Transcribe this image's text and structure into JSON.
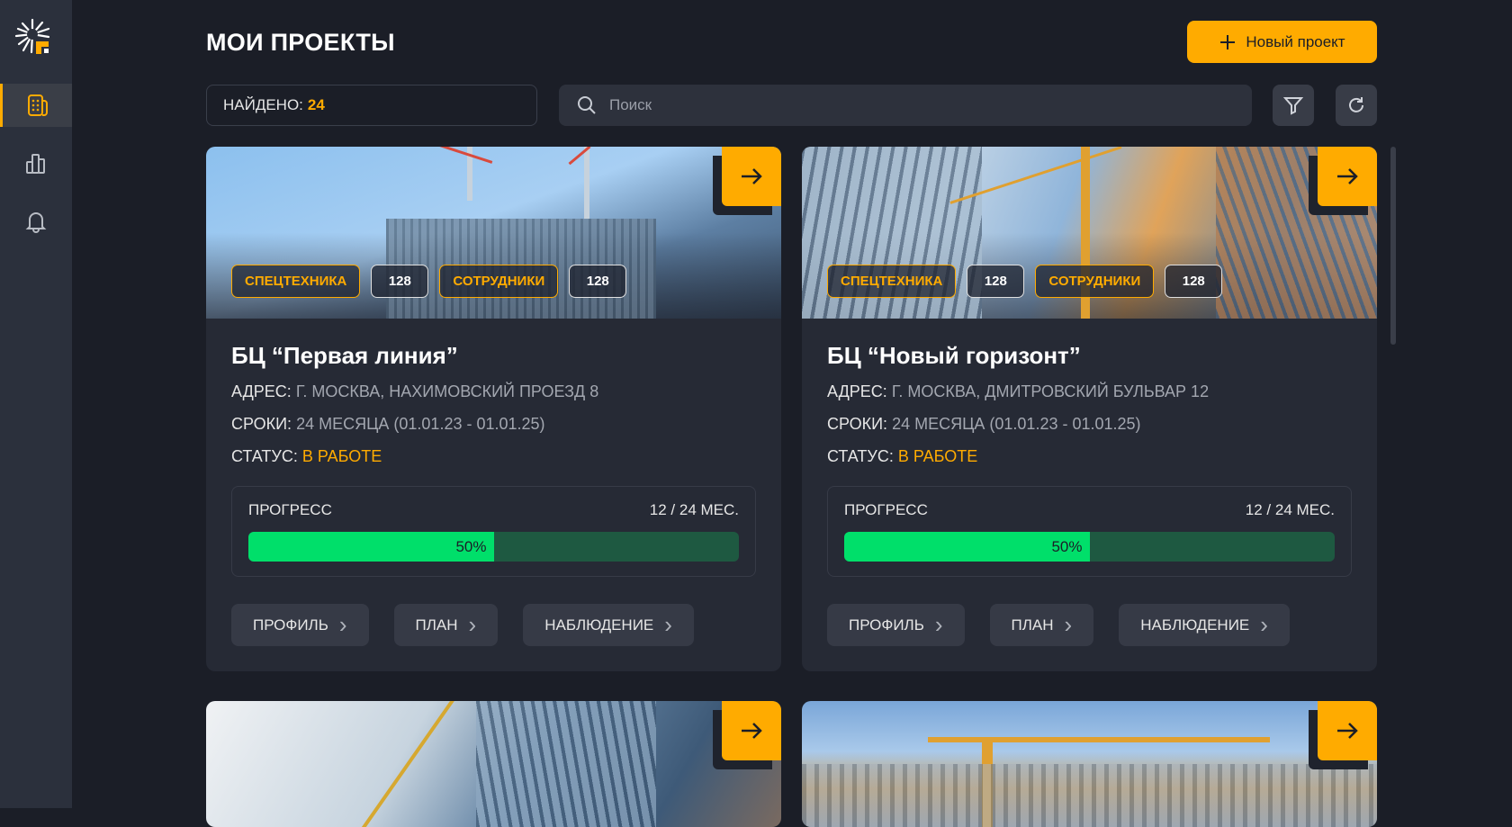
{
  "sidebar": {
    "items": [
      {
        "name": "projects",
        "active": true
      },
      {
        "name": "analytics"
      },
      {
        "name": "notifications"
      }
    ]
  },
  "header": {
    "title": "МОИ ПРОЕКТЫ",
    "new_project": "Новый проект"
  },
  "toolbar": {
    "found_label": "НАЙДЕНО:",
    "found_count": "24",
    "search_placeholder": "Поиск"
  },
  "colors": {
    "accent": "#ffab00",
    "progress": "#00df6a",
    "background": "#1b1e27"
  },
  "projects": [
    {
      "tag1": "СПЕЦТЕХНИКА",
      "tag1_count": "128",
      "tag2": "СОТРУДНИКИ",
      "tag2_count": "128",
      "name": "БЦ “Первая линия”",
      "address_label": "АДРЕС:",
      "address": "Г. МОСКВА, НАХИМОВСКИЙ ПРОЕЗД 8",
      "dates_label": "СРОКИ:",
      "dates": "24 МЕСЯЦА (01.01.23 - 01.01.25)",
      "status_label": "СТАТУС:",
      "status": "В РАБОТЕ",
      "progress_label": "ПРОГРЕСС",
      "progress_months": "12 / 24 МЕС.",
      "progress_percent": 50,
      "progress_text": "50%",
      "btn_profile": "ПРОФИЛЬ",
      "btn_plan": "ПЛАН",
      "btn_watch": "НАБЛЮДЕНИЕ"
    },
    {
      "tag1": "СПЕЦТЕХНИКА",
      "tag1_count": "128",
      "tag2": "СОТРУДНИКИ",
      "tag2_count": "128",
      "name": "БЦ “Новый горизонт”",
      "address_label": "АДРЕС:",
      "address": "Г. МОСКВА, ДМИТРОВСКИЙ БУЛЬВАР 12",
      "dates_label": "СРОКИ:",
      "dates": "24 МЕСЯЦА (01.01.23 - 01.01.25)",
      "status_label": "СТАТУС:",
      "status": "В РАБОТЕ",
      "progress_label": "ПРОГРЕСС",
      "progress_months": "12 / 24 МЕС.",
      "progress_percent": 50,
      "progress_text": "50%",
      "btn_profile": "ПРОФИЛЬ",
      "btn_plan": "ПЛАН",
      "btn_watch": "НАБЛЮДЕНИЕ"
    }
  ]
}
